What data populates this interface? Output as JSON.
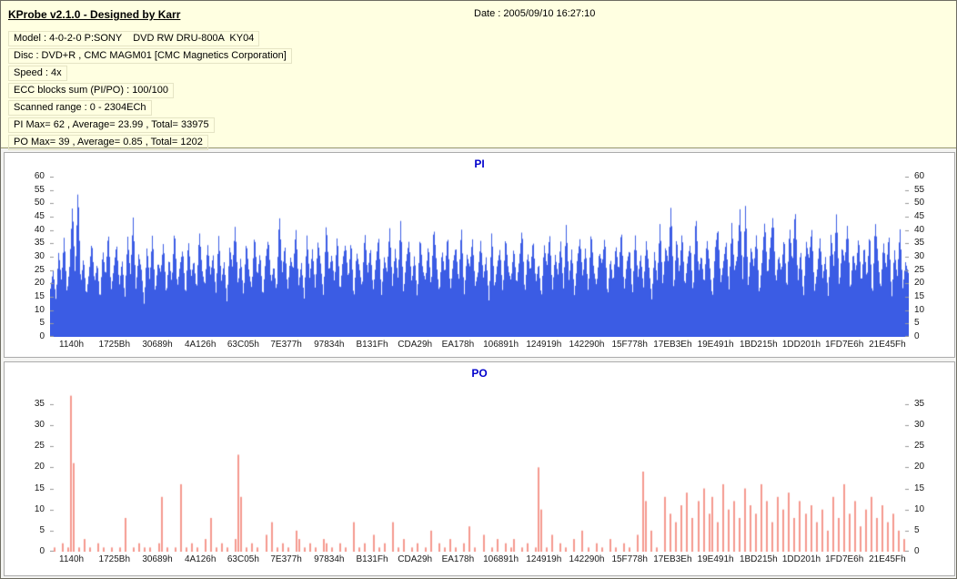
{
  "header": {
    "title": "KProbe v2.1.0 - Designed by Karr",
    "date": "Date : 2005/09/10 16:27:10"
  },
  "info": {
    "lines": [
      "Model : 4-0-2-0 P:SONY    DVD RW DRU-800A  KY04",
      "Disc : DVD+R , CMC MAGM01 [CMC Magnetics Corporation]",
      "Speed : 4x",
      "ECC blocks sum (PI/PO) : 100/100",
      "Scanned range : 0 - 2304ECh",
      "PI Max= 62 , Average= 23.99 , Total= 33975",
      "PO Max= 39 , Average= 0.85 , Total= 1202"
    ]
  },
  "colors": {
    "header_bg": "#ffffe1",
    "chart_title": "#0000cc",
    "pi_bar": "#3b5ce4",
    "po_bar": "#f4998f",
    "axis_text": "#1a1a1a"
  },
  "chart_data": [
    {
      "type": "bar",
      "title": "PI",
      "render": "filled",
      "bar_color": "#3b5ce4",
      "ylim": [
        0,
        60
      ],
      "yticks": [
        0,
        5,
        10,
        15,
        20,
        25,
        30,
        35,
        40,
        45,
        50,
        55,
        60
      ],
      "stats": {
        "max": 62,
        "average": 23.99,
        "total": 33975
      },
      "x_labels": [
        "1140h",
        "1725Bh",
        "30689h",
        "4A126h",
        "63C05h",
        "7E377h",
        "97834h",
        "B131Fh",
        "CDA29h",
        "EA178h",
        "106891h",
        "124919h",
        "142290h",
        "15F778h",
        "17EB3Eh",
        "19E491h",
        "1BD215h",
        "1DD201h",
        "1FD7E6h",
        "21E45Fh"
      ],
      "values": [
        18,
        25,
        14,
        32,
        21,
        38,
        16,
        27,
        50,
        22,
        57,
        19,
        30,
        15,
        24,
        36,
        20,
        28,
        13,
        33,
        22,
        40,
        17,
        26,
        35,
        19,
        29,
        14,
        38,
        23,
        45,
        18,
        31,
        25,
        12,
        34,
        21,
        39,
        16,
        28,
        24,
        36,
        15,
        30,
        20,
        41,
        18,
        27,
        33,
        14,
        37,
        22,
        29,
        17,
        40,
        25,
        19,
        35,
        23,
        31,
        16,
        38,
        21,
        28,
        13,
        34,
        26,
        42,
        19,
        30,
        15,
        36,
        24,
        18,
        39,
        22,
        32,
        14,
        29,
        37,
        20,
        27,
        16,
        47,
        23,
        35,
        17,
        30,
        25,
        41,
        19,
        28,
        14,
        38,
        22,
        33,
        18,
        36,
        27,
        15,
        43,
        24,
        31,
        20,
        39,
        16,
        29,
        35,
        21,
        37,
        13,
        32,
        26,
        18,
        40,
        23,
        34,
        17,
        28,
        38,
        15,
        30,
        24,
        41,
        19,
        33,
        22,
        44,
        16,
        29,
        36,
        20,
        31,
        14,
        38,
        25,
        21,
        35,
        18,
        42,
        27,
        16,
        33,
        23,
        39,
        17,
        28,
        34,
        20,
        42,
        15,
        31,
        26,
        37,
        19,
        24,
        36,
        22,
        30,
        13,
        40,
        18,
        27,
        33,
        16,
        38,
        25,
        21,
        34,
        19,
        29,
        41,
        15,
        32,
        24,
        37,
        20,
        28,
        14,
        35,
        26,
        39,
        17,
        31,
        23,
        36,
        18,
        42,
        21,
        33,
        15,
        29,
        37,
        22,
        34,
        16,
        40,
        25,
        19,
        32,
        27,
        38,
        14,
        30,
        20,
        35,
        24,
        41,
        17,
        28,
        33,
        15,
        39,
        22,
        31,
        18,
        36,
        26,
        14,
        32,
        21,
        43,
        19,
        34,
        28,
        50,
        16,
        38,
        23,
        40,
        18,
        29,
        35,
        15,
        47,
        24,
        31,
        19,
        37,
        27,
        14,
        33,
        41,
        20,
        28,
        36,
        17,
        43,
        25,
        30,
        48,
        21,
        50,
        18,
        34,
        26,
        39,
        15,
        29,
        44,
        22,
        35,
        46,
        19,
        31,
        24,
        38,
        16,
        42,
        27,
        49,
        20,
        33,
        14,
        36,
        29,
        41,
        17,
        25,
        37,
        22,
        30,
        15,
        39,
        26,
        47,
        18,
        34,
        28,
        43,
        16,
        32,
        24,
        38,
        19,
        35,
        21,
        40,
        13,
        44,
        30,
        17,
        36,
        25,
        39,
        14,
        33,
        22,
        41,
        18,
        28,
        24
      ]
    },
    {
      "type": "bar",
      "title": "PO",
      "render": "spikes",
      "bar_color": "#f4998f",
      "ylim": [
        0,
        38
      ],
      "yticks": [
        0,
        5,
        10,
        15,
        20,
        25,
        30,
        35
      ],
      "stats": {
        "max": 39,
        "average": 0.85,
        "total": 1202
      },
      "x_labels": [
        "1140h",
        "1725Bh",
        "30689h",
        "4A126h",
        "63C05h",
        "7E377h",
        "97834h",
        "B131Fh",
        "CDA29h",
        "EA178h",
        "106891h",
        "124919h",
        "142290h",
        "15F778h",
        "17EB3Eh",
        "19E491h",
        "1BD215h",
        "1DD201h",
        "1FD7E6h",
        "21E45Fh"
      ],
      "values": [
        0,
        1,
        0,
        0,
        2,
        0,
        1,
        37,
        21,
        0,
        1,
        0,
        3,
        0,
        1,
        0,
        0,
        2,
        0,
        1,
        0,
        0,
        1,
        0,
        0,
        1,
        0,
        8,
        0,
        0,
        1,
        0,
        2,
        0,
        1,
        0,
        1,
        0,
        0,
        2,
        13,
        0,
        1,
        0,
        0,
        1,
        0,
        16,
        0,
        1,
        0,
        2,
        0,
        1,
        0,
        0,
        3,
        0,
        8,
        0,
        1,
        0,
        2,
        0,
        1,
        0,
        0,
        3,
        23,
        13,
        0,
        1,
        0,
        2,
        0,
        1,
        0,
        0,
        4,
        0,
        7,
        0,
        1,
        0,
        2,
        0,
        1,
        0,
        0,
        5,
        3,
        0,
        1,
        0,
        2,
        0,
        1,
        0,
        0,
        3,
        2,
        0,
        1,
        0,
        0,
        2,
        0,
        1,
        0,
        0,
        7,
        0,
        1,
        0,
        2,
        0,
        0,
        4,
        0,
        1,
        0,
        2,
        0,
        0,
        7,
        0,
        1,
        0,
        3,
        0,
        0,
        1,
        0,
        2,
        0,
        0,
        1,
        0,
        5,
        0,
        0,
        2,
        0,
        1,
        0,
        3,
        0,
        1,
        0,
        0,
        2,
        0,
        6,
        0,
        1,
        0,
        0,
        4,
        0,
        0,
        1,
        0,
        3,
        0,
        0,
        2,
        0,
        1,
        3,
        0,
        0,
        1,
        0,
        2,
        0,
        0,
        1,
        20,
        10,
        0,
        1,
        0,
        4,
        0,
        0,
        2,
        0,
        1,
        0,
        0,
        3,
        0,
        0,
        5,
        0,
        1,
        0,
        0,
        2,
        0,
        1,
        0,
        0,
        3,
        0,
        1,
        0,
        0,
        2,
        0,
        1,
        0,
        0,
        4,
        0,
        19,
        12,
        0,
        5,
        0,
        1,
        0,
        0,
        13,
        0,
        9,
        0,
        7,
        0,
        11,
        0,
        14,
        0,
        8,
        0,
        12,
        0,
        15,
        0,
        9,
        13,
        0,
        7,
        0,
        16,
        0,
        10,
        0,
        12,
        0,
        8,
        0,
        15,
        0,
        11,
        0,
        9,
        0,
        16,
        0,
        12,
        0,
        7,
        0,
        13,
        0,
        10,
        0,
        14,
        0,
        8,
        0,
        12,
        0,
        9,
        0,
        11,
        0,
        7,
        0,
        10,
        0,
        5,
        0,
        13,
        0,
        8,
        0,
        16,
        0,
        9,
        0,
        12,
        0,
        6,
        0,
        10,
        0,
        13,
        0,
        8,
        0,
        11,
        0,
        7,
        0,
        9,
        0,
        5,
        0,
        3,
        0
      ]
    }
  ]
}
